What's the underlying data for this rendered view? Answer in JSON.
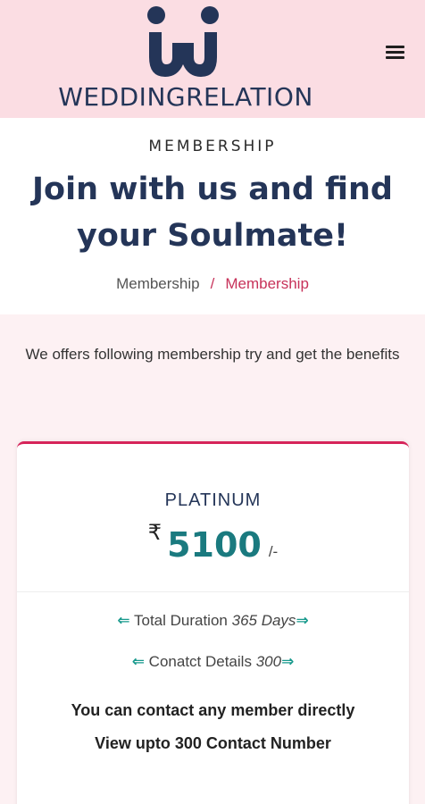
{
  "header": {
    "logo_text": "WEDDINGRELATION",
    "brand_color": "#243558",
    "background": "#fbdde3",
    "menu_icon": "hamburger-menu-icon"
  },
  "hero": {
    "eyebrow": "MEMBERSHIP",
    "title": "Join with us and find your Soulmate!",
    "breadcrumb": {
      "home": "Membership",
      "separator": "/",
      "current": "Membership"
    }
  },
  "intro": "We offers following membership try and get the benefits",
  "plan": {
    "name": "PLATINUM",
    "currency": "₹",
    "amount": "5100",
    "suffix": "/-",
    "accent_color": "#d6245a",
    "price_color": "#1a7a7f",
    "features": [
      {
        "arrow_left": "⇐",
        "label": "Total Duration",
        "value": "365 Days",
        "arrow_right": "⇒"
      },
      {
        "arrow_left": "⇐",
        "label": "Conatct Details",
        "value": "300",
        "arrow_right": "⇒"
      }
    ],
    "benefits": [
      "You can contact any member directly",
      "View upto 300 Contact Number"
    ]
  }
}
